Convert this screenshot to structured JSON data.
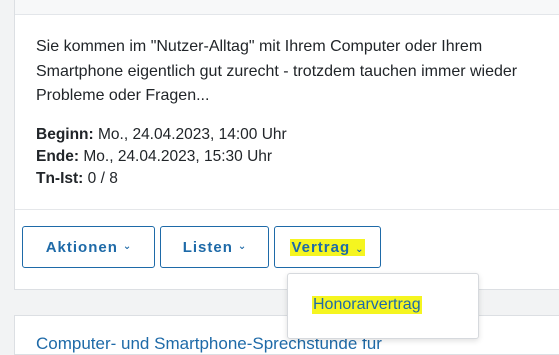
{
  "course": {
    "description": "Sie kommen im \"Nutzer-Alltag\" mit Ihrem Computer oder Ihrem Smartphone eigentlich gut zurecht - trotzdem tauchen immer wieder Probleme oder Fragen...",
    "begin_label": "Beginn:",
    "begin_value": " Mo., 24.04.2023, 14:00 Uhr",
    "end_label": "Ende:",
    "end_value": " Mo., 24.04.2023, 15:30 Uhr",
    "tn_label": "Tn-Ist:",
    "tn_value": " 0 / 8"
  },
  "actions": {
    "aktionen_label": "Aktionen",
    "listen_label": "Listen",
    "vertrag_label": "Vertrag",
    "chevron_icon": "chevron-down-icon"
  },
  "vertrag_menu": {
    "items": [
      "Honorarvertrag"
    ]
  },
  "next_card": {
    "title": "Computer- und Smartphone-Sprechstunde für"
  },
  "colors": {
    "accent": "#1e6aa8",
    "highlight": "#f5f520"
  }
}
